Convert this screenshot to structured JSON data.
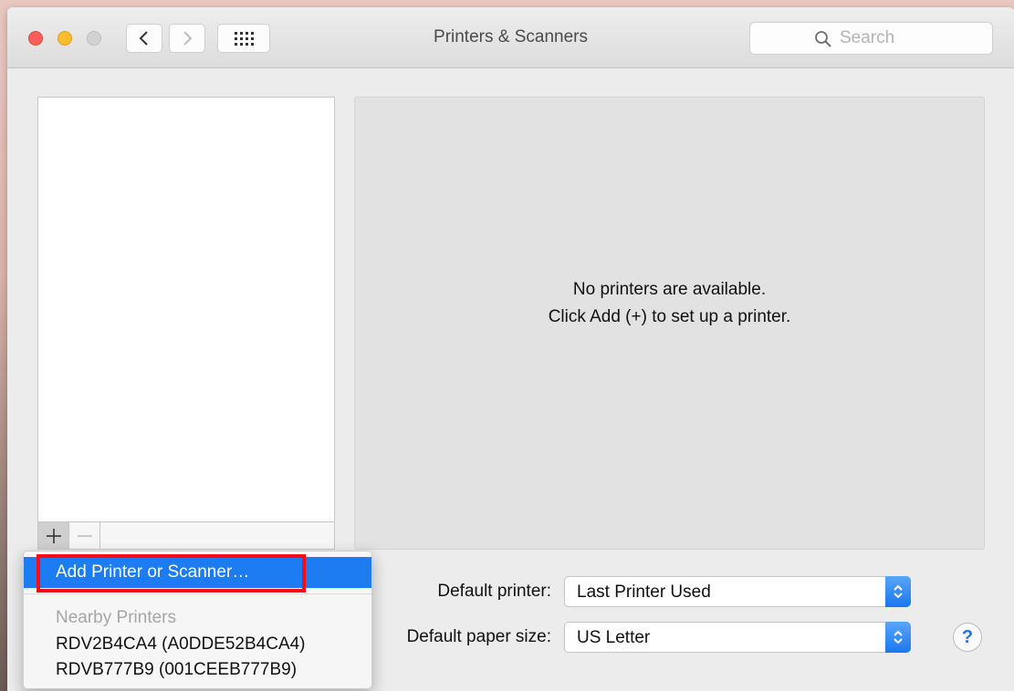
{
  "window": {
    "title": "Printers & Scanners"
  },
  "toolbar": {
    "search_placeholder": "Search"
  },
  "printer_list": {
    "items": []
  },
  "detail": {
    "message_line1": "No printers are available.",
    "message_line2": "Click Add (+) to set up a printer."
  },
  "settings": {
    "default_printer_label": "Default printer:",
    "default_printer_value": "Last Printer Used",
    "paper_size_label": "Default paper size:",
    "paper_size_value": "US Letter"
  },
  "help": {
    "glyph": "?"
  },
  "add_menu": {
    "add_item": "Add Printer or Scanner…",
    "section_header": "Nearby Printers",
    "nearby": [
      "RDV2B4CA4 (A0DDE52B4CA4)",
      "RDVB777B9 (001CEEB777B9)"
    ]
  },
  "colors": {
    "accent": "#1d7cf2",
    "annotation_red": "#ff0a14",
    "close": "#fc5f57",
    "minimize": "#fdbc2e"
  },
  "icons": {
    "back": "chevron-left-icon",
    "forward": "chevron-right-icon",
    "grid": "grid-icon",
    "search": "magnifier-icon",
    "add": "plus-icon",
    "remove": "minus-icon",
    "popup": "up-down-chevron-icon"
  }
}
